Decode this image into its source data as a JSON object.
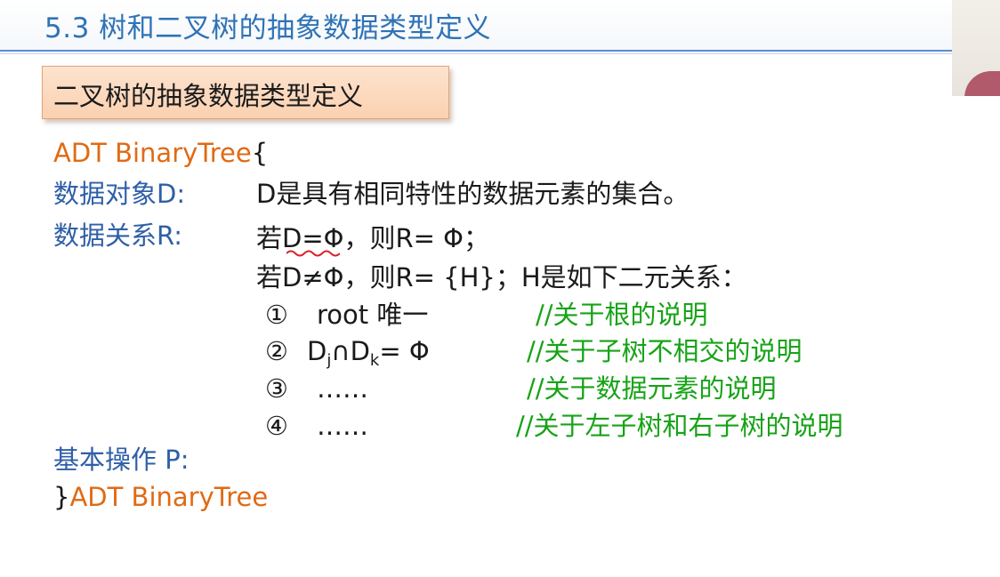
{
  "header": {
    "title": "5.3 树和二叉树的抽象数据类型定义"
  },
  "subtitle": "二叉树的抽象数据类型定义",
  "adt": {
    "open": "ADT BinaryTree",
    "open_brace": "{",
    "data_object_label": "数据对象D:",
    "data_object_value": "D是具有相同特性的数据元素的集合。",
    "data_relation_label": "数据关系R:",
    "relation_line1": "若D=Φ，则R= Φ；",
    "relation_line2": "若D≠Φ，则R= {H}；H是如下二元关系：",
    "items": [
      {
        "marker": "①",
        "text": "root 唯一",
        "comment": "//关于根的说明"
      },
      {
        "marker": "②",
        "d1": "D",
        "sub1": "j",
        "cap": "∩D",
        "sub2": "k",
        "tail": "= Φ",
        "comment": "//关于子树不相交的说明"
      },
      {
        "marker": "③",
        "text": "……",
        "comment": "//关于数据元素的说明"
      },
      {
        "marker": "④",
        "text": "……",
        "comment": "//关于左子树和右子树的说明"
      }
    ],
    "ops_label": "基本操作 P:",
    "close_brace": "}",
    "close": "ADT BinaryTree"
  },
  "colors": {
    "title": "#2f73b6",
    "keyword": "#e06a14",
    "label": "#2f5fa7",
    "comment": "#17a317",
    "subtitle_bg": "#fbd1b0"
  }
}
